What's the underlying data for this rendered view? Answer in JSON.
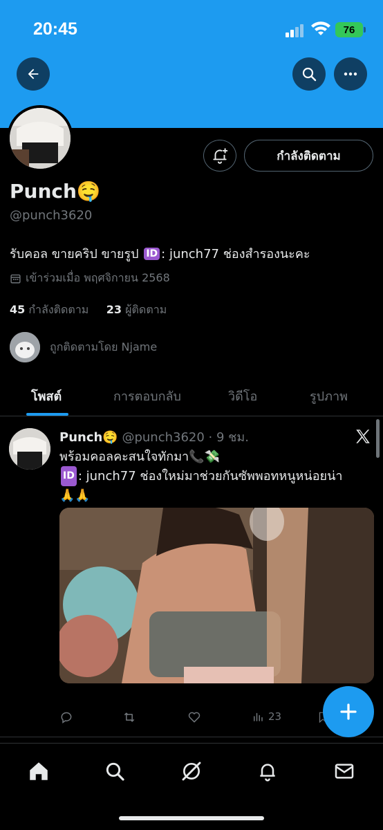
{
  "status_bar": {
    "time": "20:45",
    "battery": "76"
  },
  "header": {
    "back_icon": "arrow-left-icon",
    "search_icon": "search-icon",
    "more_icon": "more-horizontal-icon"
  },
  "profile": {
    "name": "Punch🤤",
    "handle": "@punch3620",
    "bio_prefix": "รับคอล ขายคริป ขายรูป",
    "bio_badge": "ID",
    "bio_suffix": ": junch77 ช่องสำรองนะคะ",
    "joined": "เข้าร่วมเมื่อ พฤศจิกายน 2568",
    "following_count": "45",
    "following_label": "กำลังติดตาม",
    "followers_count": "23",
    "followers_label": "ผู้ติดตาม",
    "followed_by": "ถูกติดตามโดย Njame",
    "follow_button": "กำลังติดตาม"
  },
  "tabs": [
    {
      "label": "โพสต์",
      "active": true
    },
    {
      "label": "การตอบกลับ",
      "active": false
    },
    {
      "label": "วิดีโอ",
      "active": false
    },
    {
      "label": "รูปภาพ",
      "active": false
    }
  ],
  "post": {
    "name": "Punch🤤",
    "meta": "@punch3620 · 9 ชม.",
    "line1": "พร้อมคอลคะสนใจทักมา📞💸",
    "badge": "ID",
    "line2": ": junch77 ช่องใหม่มาช่วยกันซัพพอทหนูหน่อยน่า",
    "line3": "🙏🙏",
    "views": "23"
  },
  "colors": {
    "accent": "#1d9bf0",
    "background": "#000000",
    "muted": "#71767b"
  }
}
